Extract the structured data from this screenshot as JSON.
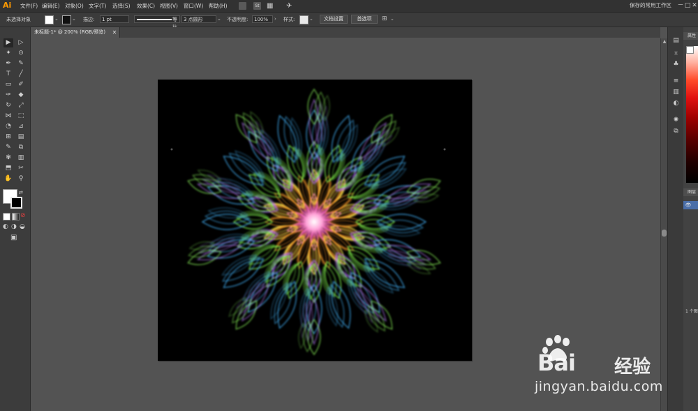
{
  "app": {
    "logo": "Ai",
    "workspace": "保存的常用工作区",
    "window_controls": [
      "－",
      "□",
      "✕"
    ]
  },
  "menus": [
    "文件(F)",
    "编辑(E)",
    "对象(O)",
    "文字(T)",
    "选择(S)",
    "效果(C)",
    "视图(V)",
    "窗口(W)",
    "帮助(H)"
  ],
  "menubar_icons": [
    "bridge-icon",
    "stock-icon",
    "arrange-icon",
    "gpu-icon"
  ],
  "menubar_glyphs": {
    "stock": "St",
    "arrange": "▦",
    "gpu": "✈"
  },
  "control": {
    "selection_label": "未选择对象",
    "stroke_label": "描边:",
    "stroke_weight": "1 pt",
    "stroke_style": "等比",
    "brush": "3 点圆形",
    "opacity_label": "不透明度:",
    "opacity_value": "100%",
    "style_label": "样式:",
    "doc_setup_button": "文档设置",
    "prefs_button": "首选项",
    "extra_glyph": "⊞",
    "fill_color": "#ffffff",
    "stroke_color": "#000000"
  },
  "document": {
    "tab_title": "未标题-1* @ 200% (RGB/预览)",
    "close": "✕",
    "artboard_color": "#000000"
  },
  "tools": [
    [
      "selection-tool",
      "▶"
    ],
    [
      "direct-selection-tool",
      "▷"
    ],
    [
      "magic-wand-tool",
      "✦"
    ],
    [
      "lasso-tool",
      "⊙"
    ],
    [
      "pen-tool",
      "✒"
    ],
    [
      "curvature-tool",
      "✎"
    ],
    [
      "type-tool",
      "T"
    ],
    [
      "line-tool",
      "╱"
    ],
    [
      "rectangle-tool",
      "▭"
    ],
    [
      "paintbrush-tool",
      "✐"
    ],
    [
      "shaper-tool",
      "✑"
    ],
    [
      "eraser-tool",
      "◆"
    ],
    [
      "rotate-tool",
      "↻"
    ],
    [
      "scale-tool",
      "⤢"
    ],
    [
      "width-tool",
      "⋈"
    ],
    [
      "free-transform-tool",
      "⬚"
    ],
    [
      "shape-builder-tool",
      "◔"
    ],
    [
      "perspective-tool",
      "⊿"
    ],
    [
      "mesh-tool",
      "⊞"
    ],
    [
      "gradient-tool",
      "▤"
    ],
    [
      "eyedropper-tool",
      "✎"
    ],
    [
      "blend-tool",
      "⧉"
    ],
    [
      "symbol-sprayer-tool",
      "✾"
    ],
    [
      "column-graph-tool",
      "▥"
    ],
    [
      "artboard-tool",
      "⬒"
    ],
    [
      "slice-tool",
      "✂"
    ],
    [
      "hand-tool",
      "✋"
    ],
    [
      "zoom-tool",
      "⚲"
    ]
  ],
  "toolbar_misc": {
    "swap": "⇄",
    "color_mode": "■",
    "gradient_mode": "▨",
    "none_mode": "⊘",
    "draw_normal": "◐",
    "draw_behind": "◑",
    "draw_inside": "◒",
    "screen_mode": "▣"
  },
  "dock_icons": [
    [
      "libraries-icon",
      "▤"
    ],
    [
      "properties-icon",
      "⌗"
    ],
    [
      "club-icon",
      "♣"
    ],
    [
      "stroke-panel-icon",
      "≡"
    ],
    [
      "gradient-panel-icon",
      "▥"
    ],
    [
      "transparency-icon",
      "◐"
    ],
    [
      "appearance-icon",
      "✺"
    ],
    [
      "export-icon",
      "⧉"
    ]
  ],
  "panels": {
    "color_tab": "属性",
    "layers_tab": "图层",
    "layer_count": "1 个图",
    "eye": "👁",
    "scroll_up": "▲"
  },
  "watermark": {
    "brand": "Bai",
    "brand_after": "经验",
    "url": "jingyan.baidu.com"
  }
}
